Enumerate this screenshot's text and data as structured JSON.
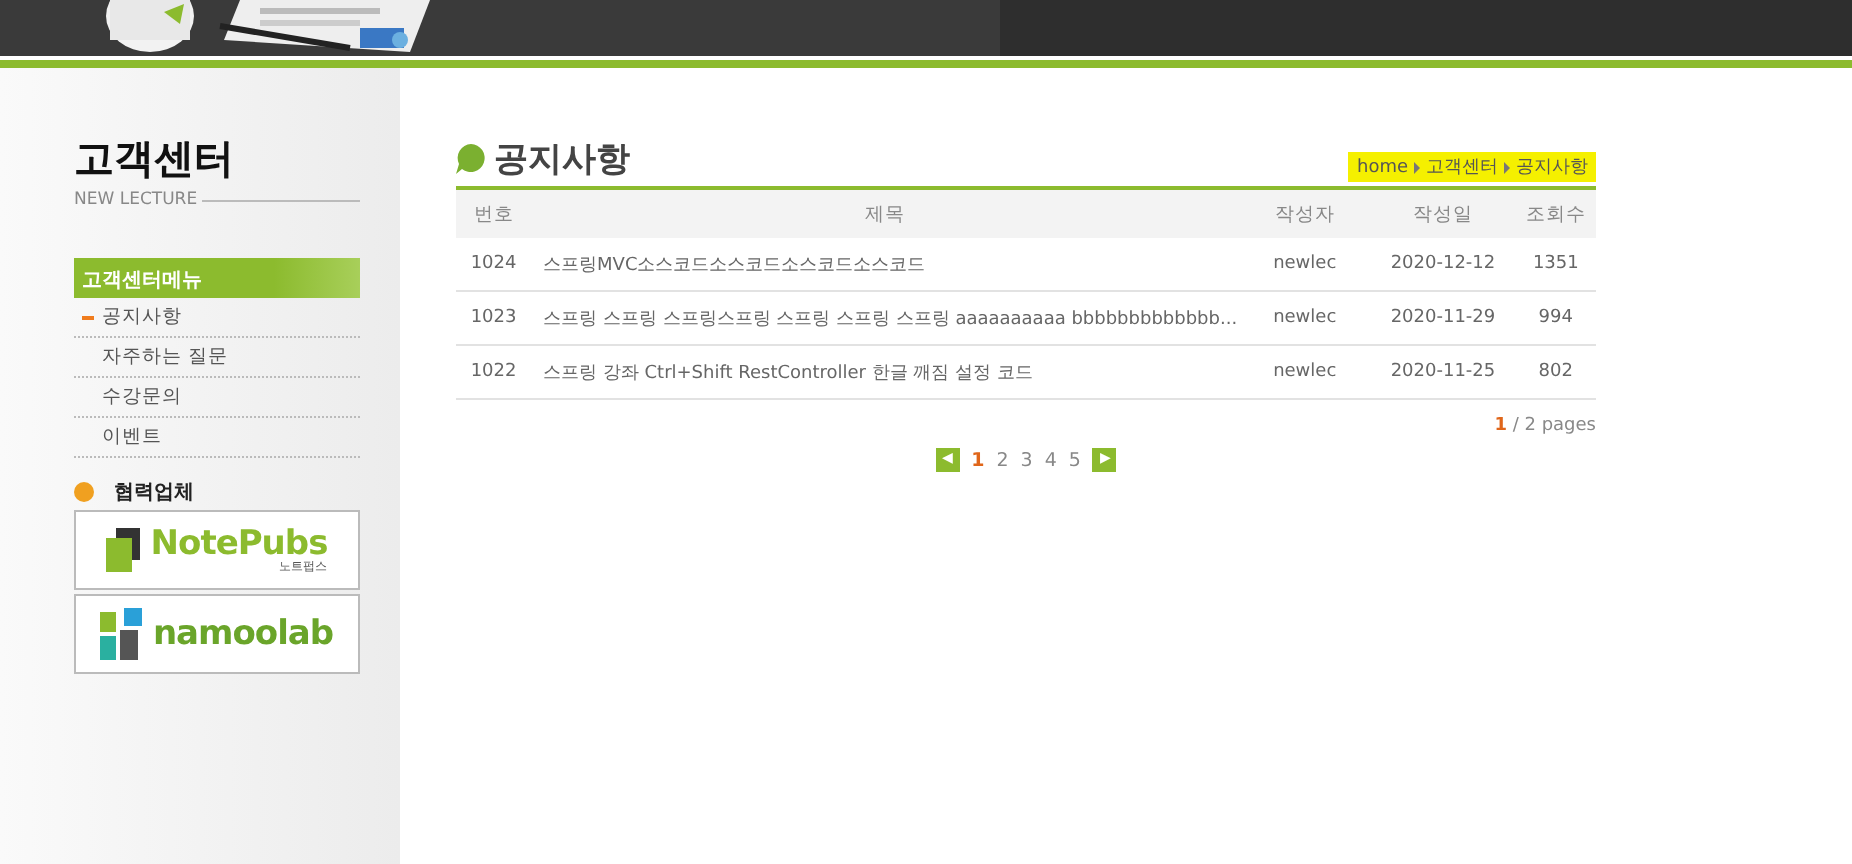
{
  "sidebar": {
    "title": "고객센터",
    "subtitle": "NEW LECTURE",
    "menu_title": "고객센터메뉴",
    "items": [
      {
        "label": "공지사항",
        "selected": true
      },
      {
        "label": "자주하는 질문",
        "selected": false
      },
      {
        "label": "수강문의",
        "selected": false
      },
      {
        "label": "이벤트",
        "selected": false
      }
    ],
    "partners_title": "협력업체",
    "partners": [
      {
        "kind": "notepubs",
        "name": "NotePubs",
        "caption": "노트펍스"
      },
      {
        "kind": "namoolab",
        "name": "namoolab"
      }
    ]
  },
  "main": {
    "title": "공지사항",
    "breadcrumb": [
      {
        "label": "home"
      },
      {
        "label": "고객센터"
      },
      {
        "label": "공지사항"
      }
    ],
    "table": {
      "columns": [
        "번호",
        "제목",
        "작성자",
        "작성일",
        "조회수"
      ],
      "rows": [
        [
          "1024",
          "스프링MVC소스코드소스코드소스코드소스코드",
          "newlec",
          "2020-12-12",
          "1351"
        ],
        [
          "1023",
          "스프링 스프링 스프링스프링 스프링 스프링 스프링 aaaaaaaaaa bbbbbbbbbbbbb...",
          "newlec",
          "2020-11-29",
          "994"
        ],
        [
          "1022",
          "스프링 강좌 Ctrl+Shift RestController 한글 깨짐 설정 코드",
          "newlec",
          "2020-11-25",
          "802"
        ]
      ]
    },
    "page_info": {
      "current": "1",
      "rest": "/ 2 pages"
    },
    "pager": {
      "prev": "◀",
      "next": "▶",
      "pages": [
        {
          "label": "1",
          "selected": true
        },
        {
          "label": "2",
          "selected": false
        },
        {
          "label": "3",
          "selected": false
        },
        {
          "label": "4",
          "selected": false
        },
        {
          "label": "5",
          "selected": false
        }
      ]
    }
  }
}
